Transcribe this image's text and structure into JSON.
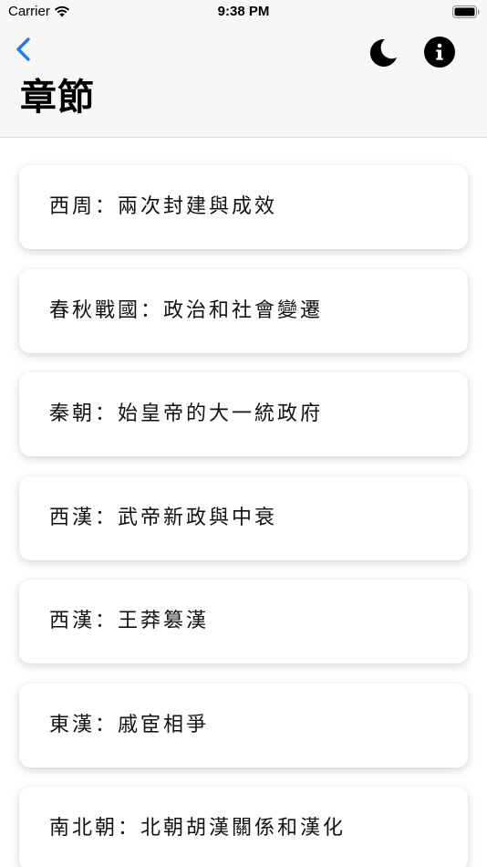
{
  "status_bar": {
    "carrier": "Carrier",
    "time": "9:38 PM"
  },
  "nav": {
    "back_icon": "chevron-left-icon",
    "theme_icon": "moon-icon",
    "info_icon": "info-circle-icon",
    "accent_color": "#1a7cf5"
  },
  "page": {
    "title": "章節"
  },
  "chapters": [
    {
      "label": "西周：兩次封建與成效"
    },
    {
      "label": "春秋戰國：政治和社會變遷"
    },
    {
      "label": "秦朝：始皇帝的大一統政府"
    },
    {
      "label": "西漢：武帝新政與中衰"
    },
    {
      "label": "西漢：王莽篡漢"
    },
    {
      "label": "東漢：戚宦相爭"
    },
    {
      "label": "南北朝：北朝胡漢關係和漢化"
    }
  ]
}
